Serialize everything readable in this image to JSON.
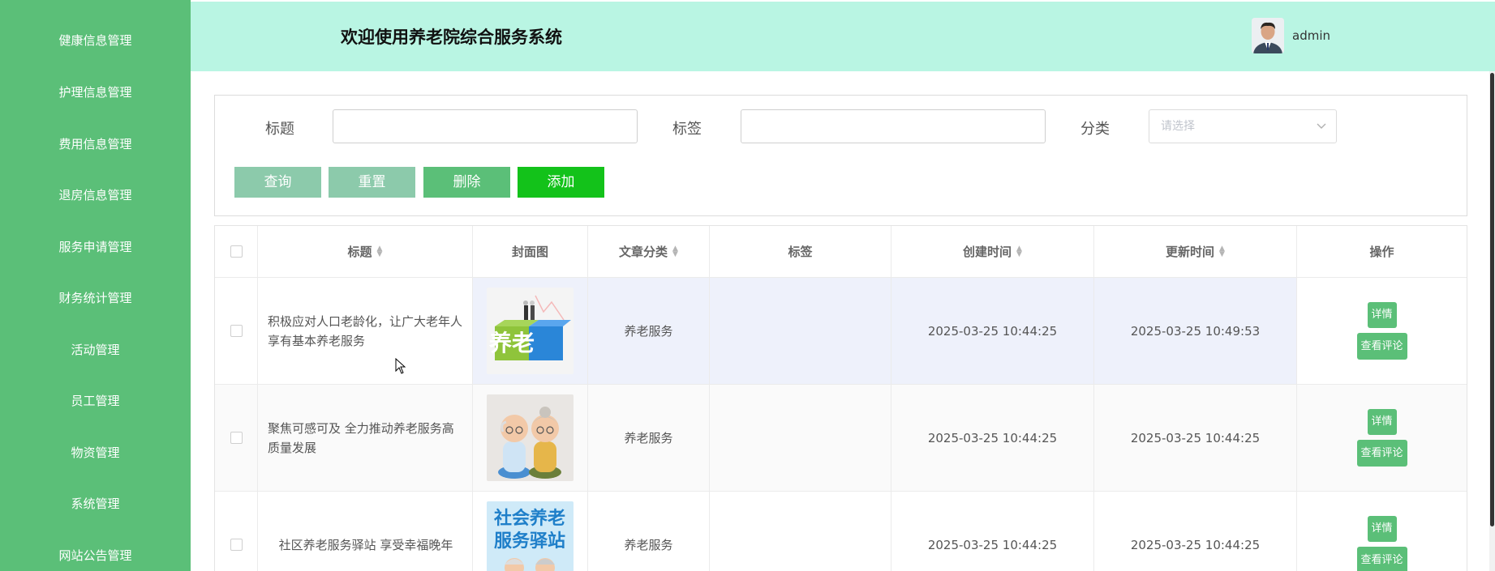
{
  "sidebar": {
    "items": [
      {
        "label": "健康信息管理"
      },
      {
        "label": "护理信息管理"
      },
      {
        "label": "费用信息管理"
      },
      {
        "label": "退房信息管理"
      },
      {
        "label": "服务申请管理"
      },
      {
        "label": "财务统计管理"
      },
      {
        "label": "活动管理"
      },
      {
        "label": "员工管理"
      },
      {
        "label": "物资管理"
      },
      {
        "label": "系统管理"
      },
      {
        "label": "网站公告管理"
      }
    ]
  },
  "header": {
    "title": "欢迎使用养老院综合服务系统",
    "username": "admin"
  },
  "search": {
    "title_label": "标题",
    "title_value": "",
    "tag_label": "标签",
    "tag_value": "",
    "category_label": "分类",
    "category_placeholder": "请选择",
    "query_button": "查询",
    "reset_button": "重置",
    "delete_button": "删除",
    "add_button": "添加"
  },
  "table": {
    "columns": [
      "标题",
      "封面图",
      "文章分类",
      "标签",
      "创建时间",
      "更新时间",
      "操作"
    ],
    "detail_label": "详情",
    "comment_label": "查看评论",
    "rows": [
      {
        "title": "积极应对人口老龄化，让广大老年人享有基本养老服务",
        "category": "养老服务",
        "tag": "",
        "created": "2025-03-25 10:44:25",
        "updated": "2025-03-25 10:49:53",
        "cover_text": "养老"
      },
      {
        "title": "聚焦可感可及 全力推动养老服务高质量发展",
        "category": "养老服务",
        "tag": "",
        "created": "2025-03-25 10:44:25",
        "updated": "2025-03-25 10:44:25",
        "cover_text": ""
      },
      {
        "title": "社区养老服务驿站 享受幸福晚年",
        "category": "养老服务",
        "tag": "",
        "created": "2025-03-25 10:44:25",
        "updated": "2025-03-25 10:44:25",
        "cover_text": "社会养老服务驿站"
      }
    ]
  },
  "colors": {
    "sidebar": "#5bbf78",
    "header": "#b9f5e3",
    "query_button": "#8ccaab",
    "reset_button": "#8ccaab",
    "delete_button": "#5bbf78",
    "add_button": "#13c21a",
    "highlight_row": "#eef1fb",
    "stripe_row": "#fafafa"
  },
  "icons": {
    "avatar": "user-avatar",
    "select_chevron": "chevron-down-icon",
    "sort": "sort-caret-icon"
  }
}
